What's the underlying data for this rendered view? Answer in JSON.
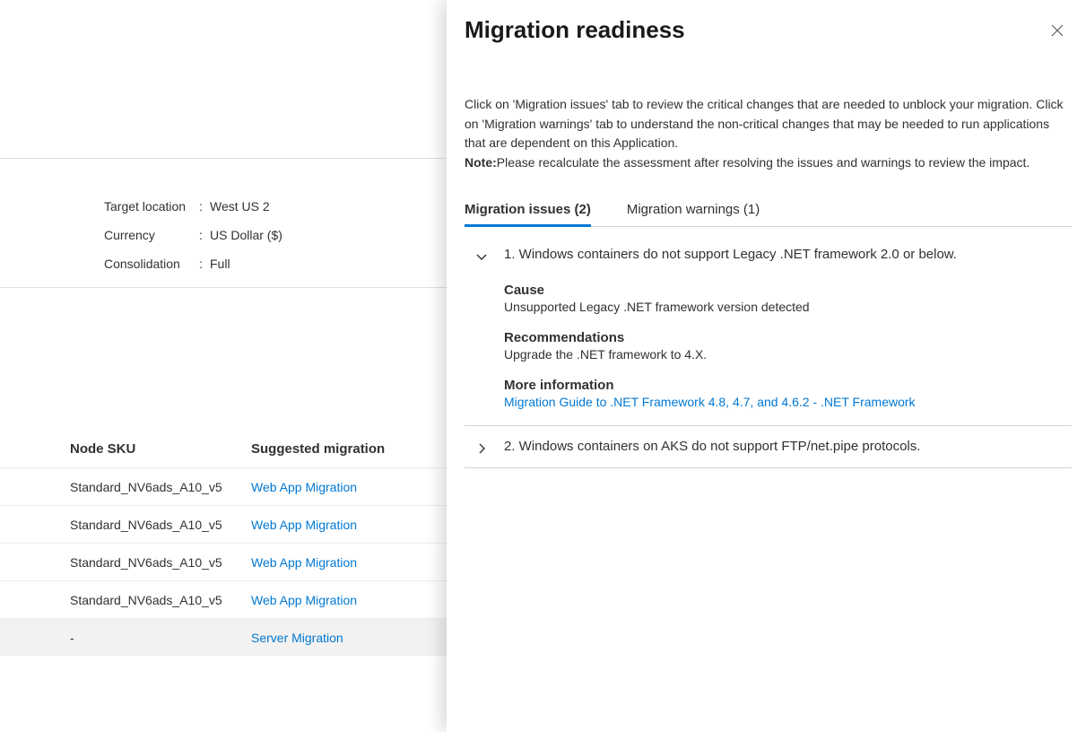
{
  "background": {
    "kv": {
      "target_location_label": "Target location",
      "target_location_value": "West US 2",
      "currency_label": "Currency",
      "currency_value": "US Dollar ($)",
      "consolidation_label": "Consolidation",
      "consolidation_value": "Full"
    },
    "table": {
      "header_sku": "Node SKU",
      "header_tool": "Suggested migration",
      "rows": [
        {
          "sku": "Standard_NV6ads_A10_v5",
          "tool": "Web App Migration"
        },
        {
          "sku": "Standard_NV6ads_A10_v5",
          "tool": "Web App Migration"
        },
        {
          "sku": "Standard_NV6ads_A10_v5",
          "tool": "Web App Migration"
        },
        {
          "sku": "Standard_NV6ads_A10_v5",
          "tool": "Web App Migration"
        },
        {
          "sku": "-",
          "tool": "Server Migration"
        }
      ]
    }
  },
  "panel": {
    "title": "Migration readiness",
    "desc_part1": "Click on 'Migration issues' tab to review the critical changes that are needed to unblock your migration. Click on 'Migration warnings' tab to understand the non-critical changes that may be needed to run applications that are dependent on this Application.",
    "desc_note_label": "Note:",
    "desc_part2": "Please recalculate the assessment after resolving the issues and warnings to review the impact.",
    "tabs": {
      "issues": "Migration issues (2)",
      "warnings": "Migration warnings (1)"
    },
    "issues": [
      {
        "title": "1. Windows containers do not support Legacy .NET framework 2.0 or below.",
        "expanded": true,
        "cause_label": "Cause",
        "cause_text": "Unsupported Legacy .NET framework version detected",
        "rec_label": "Recommendations",
        "rec_text": "Upgrade the .NET framework to 4.X.",
        "more_label": "More information",
        "more_link_text": "Migration Guide to .NET Framework 4.8, 4.7, and 4.6.2 - .NET Framework"
      },
      {
        "title": "2. Windows containers on AKS do not support FTP/net.pipe protocols.",
        "expanded": false
      }
    ]
  }
}
